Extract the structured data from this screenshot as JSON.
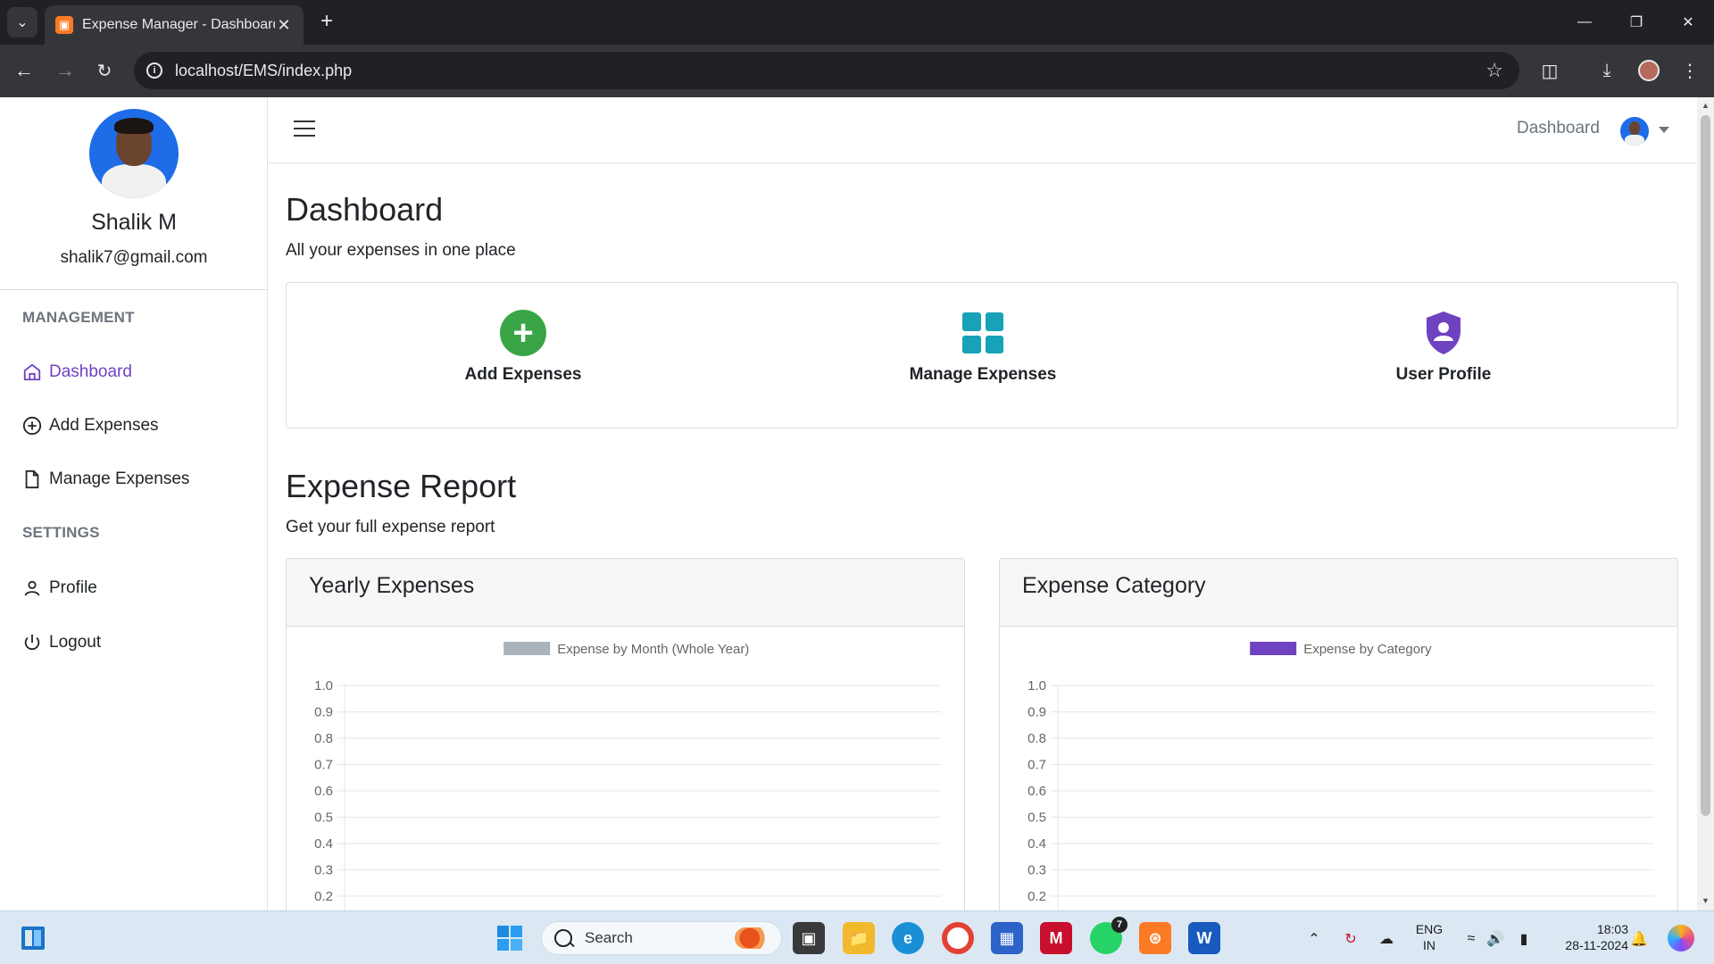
{
  "browser": {
    "tab_title": "Expense Manager - Dashboard",
    "tab_favicon_letter": "▣",
    "tab_close": "✕",
    "new_tab": "+",
    "url": "localhost/EMS/index.php",
    "window_controls": {
      "minimize": "—",
      "restore": "❐",
      "close": "✕"
    }
  },
  "sidebar": {
    "user_name": "Shalik M",
    "user_email": "shalik7@gmail.com",
    "sections": [
      {
        "heading": "MANAGEMENT",
        "items": [
          {
            "label": "Dashboard",
            "icon": "home-icon",
            "active": true
          },
          {
            "label": "Add Expenses",
            "icon": "plus-circle-icon",
            "active": false
          },
          {
            "label": "Manage Expenses",
            "icon": "file-icon",
            "active": false
          }
        ]
      },
      {
        "heading": "SETTINGS",
        "items": [
          {
            "label": "Profile",
            "icon": "user-icon",
            "active": false
          },
          {
            "label": "Logout",
            "icon": "power-icon",
            "active": false
          }
        ]
      }
    ]
  },
  "header": {
    "dashboard_link": "Dashboard"
  },
  "main": {
    "title": "Dashboard",
    "subtitle": "All your expenses in one place",
    "actions": [
      {
        "label": "Add Expenses",
        "icon": "add-circle-icon",
        "color": "#3aa547"
      },
      {
        "label": "Manage Expenses",
        "icon": "grid-icon",
        "color": "#17a2b8"
      },
      {
        "label": "User Profile",
        "icon": "shield-user-icon",
        "color": "#6f42c1"
      }
    ],
    "report_title": "Expense Report",
    "report_subtitle": "Get your full expense report"
  },
  "chart_data": [
    {
      "type": "bar",
      "title": "Yearly Expenses",
      "legend": "Expense by Month (Whole Year)",
      "legend_color": "#aab2bb",
      "series": [
        {
          "name": "Expense by Month (Whole Year)",
          "values": []
        }
      ],
      "yticks": [
        "1.0",
        "0.9",
        "0.8",
        "0.7",
        "0.6",
        "0.5",
        "0.4",
        "0.3",
        "0.2"
      ],
      "ylim": [
        0,
        1
      ],
      "legend_position": "top-center",
      "grid": true
    },
    {
      "type": "bar",
      "title": "Expense Category",
      "legend": "Expense by Category",
      "legend_color": "#6f42c1",
      "series": [
        {
          "name": "Expense by Category",
          "values": []
        }
      ],
      "yticks": [
        "1.0",
        "0.9",
        "0.8",
        "0.7",
        "0.6",
        "0.5",
        "0.4",
        "0.3",
        "0.2"
      ],
      "ylim": [
        0,
        1
      ],
      "legend_position": "top-center",
      "grid": true
    }
  ],
  "taskbar": {
    "search_placeholder": "Search",
    "whatsapp_badge": "7",
    "language": "ENG",
    "region": "IN",
    "time": "18:03",
    "date": "28-11-2024"
  },
  "colors": {
    "accent": "#6f42c1",
    "chrome_dark": "#202124",
    "chrome_toolbar": "#35363a"
  }
}
